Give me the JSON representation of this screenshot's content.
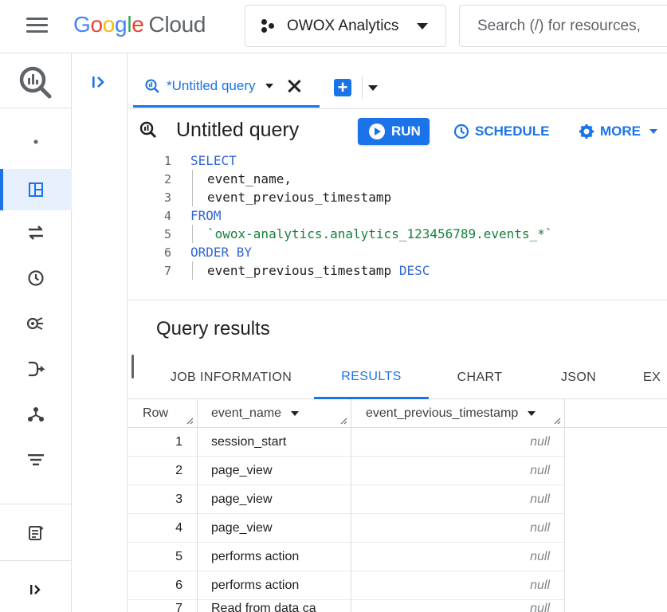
{
  "header": {
    "brand_google": [
      "G",
      "o",
      "o",
      "g",
      "l",
      "e"
    ],
    "brand_cloud": "Cloud",
    "project_name": "OWOX Analytics",
    "search_placeholder": "Search (/) for resources,"
  },
  "query_tab": {
    "label": "*Untitled query"
  },
  "toolbar": {
    "title": "Untitled query",
    "run_label": "RUN",
    "schedule_label": "SCHEDULE",
    "more_label": "MORE"
  },
  "editor": {
    "lines": [
      {
        "no": "1",
        "text": "SELECT"
      },
      {
        "no": "2",
        "text": "event_name,"
      },
      {
        "no": "3",
        "text": "event_previous_timestamp"
      },
      {
        "no": "4",
        "text": "FROM"
      },
      {
        "no": "5",
        "text": "`owox-analytics.analytics_123456789.events_*`"
      },
      {
        "no": "6",
        "text": "ORDER BY"
      },
      {
        "no": "7",
        "text": "event_previous_timestamp",
        "suffix": "DESC"
      }
    ]
  },
  "results": {
    "title": "Query results",
    "tabs": [
      "JOB INFORMATION",
      "RESULTS",
      "CHART",
      "JSON",
      "EX"
    ],
    "active_tab": "RESULTS",
    "columns": [
      "Row",
      "event_name",
      "event_previous_timestamp"
    ],
    "rows": [
      {
        "row": "1",
        "event_name": "session_start",
        "ts": "null"
      },
      {
        "row": "2",
        "event_name": "page_view",
        "ts": "null"
      },
      {
        "row": "3",
        "event_name": "page_view",
        "ts": "null"
      },
      {
        "row": "4",
        "event_name": "page_view",
        "ts": "null"
      },
      {
        "row": "5",
        "event_name": "performs action",
        "ts": "null"
      },
      {
        "row": "6",
        "event_name": "performs action",
        "ts": "null"
      },
      {
        "row": "7",
        "event_name": "Read from data ca",
        "ts": "null"
      }
    ]
  },
  "colors": {
    "accent": "#1a73e8",
    "keyword": "#3367d6",
    "string": "#188038"
  }
}
